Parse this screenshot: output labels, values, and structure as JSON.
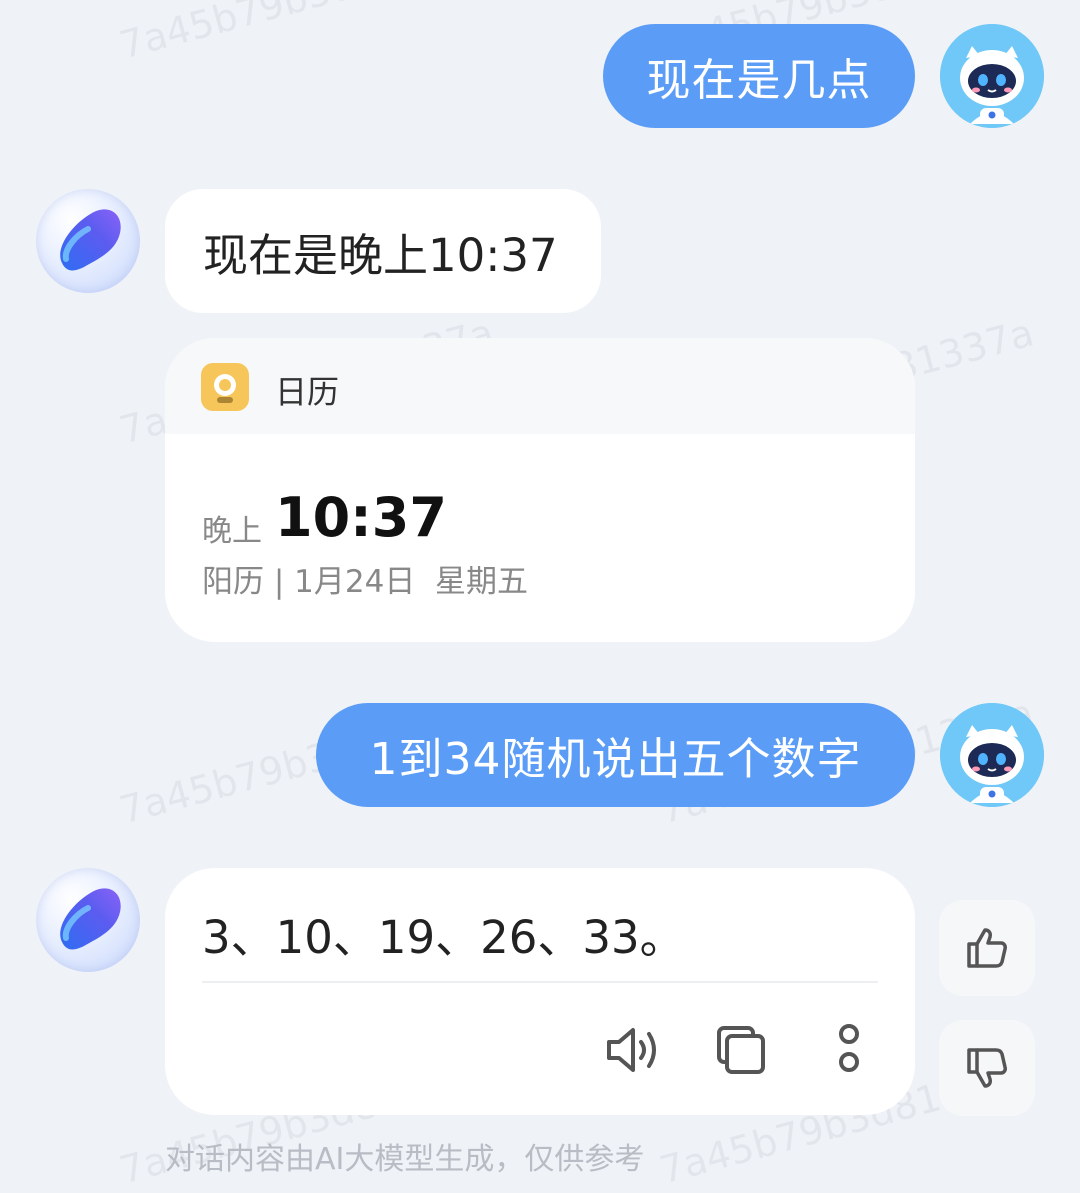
{
  "watermark_text": "7a45b79b3d81337a",
  "messages": {
    "user_1": "现在是几点",
    "ai_1": "现在是晚上10:37",
    "user_2": "1到34随机说出五个数字",
    "ai_2": "3、10、19、26、33。"
  },
  "calendar_card": {
    "app_name": "日历",
    "period": "晚上",
    "time": "10:37",
    "date_line": "阳历 | 1月24日  星期五"
  },
  "footer_note": "对话内容由AI大模型生成，仅供参考",
  "colors": {
    "user_bubble": "#5b9df6",
    "background": "#eff2f7",
    "calendar_icon": "#f7c65a",
    "user_avatar": "#6fc8f7"
  },
  "icons": [
    "robot-avatar",
    "ai-orb-avatar",
    "calendar-icon",
    "speaker-icon",
    "copy-icon",
    "more-icon",
    "thumbs-up-icon",
    "thumbs-down-icon"
  ]
}
